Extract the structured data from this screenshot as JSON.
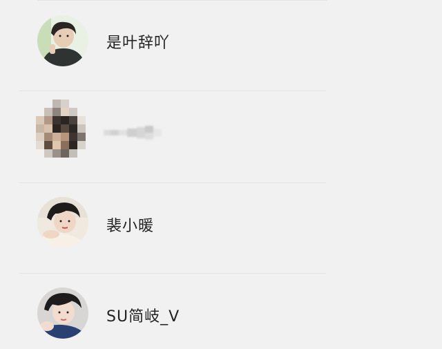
{
  "contacts": [
    {
      "name": "是叶辞吖",
      "avatar": "boy-dark-hoodie-avatar"
    },
    {
      "name": "",
      "avatar": "pixelated-avatar"
    },
    {
      "name": "裴小暖",
      "avatar": "boy-lying-avatar"
    },
    {
      "name": "SU简岐_V",
      "avatar": "boy-blue-shirt-avatar"
    }
  ],
  "colors": {
    "background": "#f1f1f1",
    "divider": "#e2e2e2",
    "text": "#222222"
  }
}
